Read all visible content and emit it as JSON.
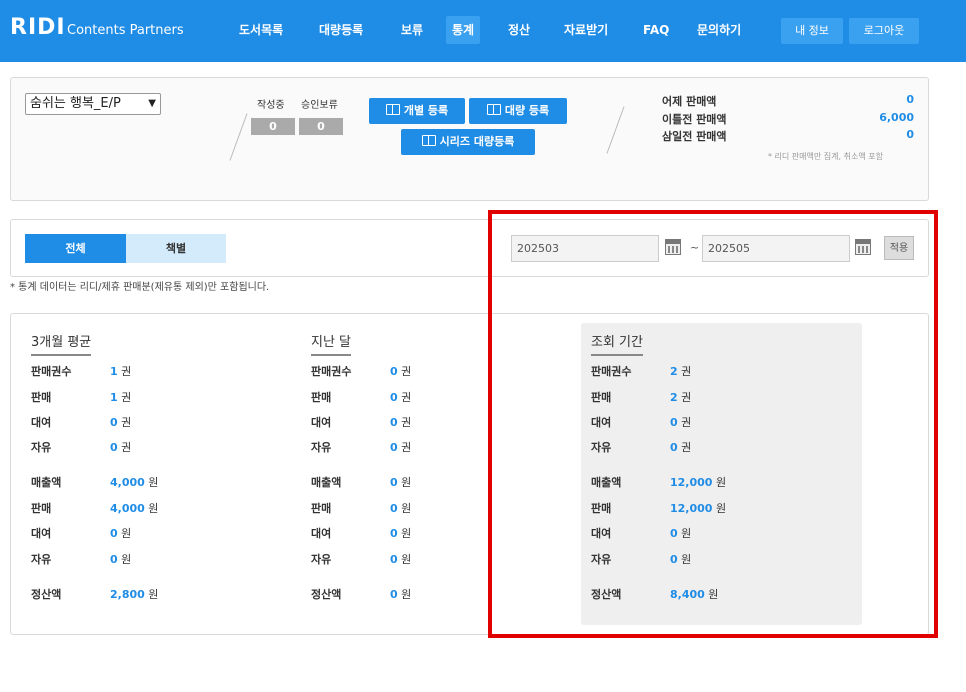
{
  "header": {
    "logo": "RIDI",
    "logo_sub": "Contents Partners",
    "nav": [
      "도서목록",
      "대량등록",
      "보류",
      "통계",
      "정산",
      "자료받기",
      "FAQ",
      "문의하기"
    ],
    "active_nav": "통계",
    "my_info": "내 정보",
    "logout": "로그아웃"
  },
  "summary": {
    "book_select": "숨쉬는 행복_E/P",
    "writing_label": "작성중",
    "writing_value": "0",
    "pending_label": "승인보류",
    "pending_value": "0",
    "btn_single": "개별 등록",
    "btn_bulk": "대량 등록",
    "btn_series": "시리즈 대량등록",
    "sales": [
      {
        "label": "어제 판매액",
        "value": "0"
      },
      {
        "label": "이틀전 판매액",
        "value": "6,000"
      },
      {
        "label": "삼일전 판매액",
        "value": "0"
      }
    ],
    "note": "* 리디 판매액만 집계, 취소액 포함"
  },
  "filter": {
    "tab_all": "전체",
    "tab_book": "책별",
    "date_from": "202503",
    "date_sep": "~",
    "date_to": "202505",
    "apply": "적용"
  },
  "notice": "* 통계 데이터는 리디/제휴 판매분(제유통 제외)만 포함됩니다.",
  "stats": {
    "unit_book": "권",
    "unit_won": "원",
    "columns": [
      {
        "title": "3개월 평균",
        "rows": {
          "sold_count": "1",
          "sale_count": "1",
          "rent_count": "0",
          "free_count": "0",
          "revenue": "4,000",
          "sale_amount": "4,000",
          "rent_amount": "0",
          "free_amount": "0",
          "settlement": "2,800"
        }
      },
      {
        "title": "지난 달",
        "rows": {
          "sold_count": "0",
          "sale_count": "0",
          "rent_count": "0",
          "free_count": "0",
          "revenue": "0",
          "sale_amount": "0",
          "rent_amount": "0",
          "free_amount": "0",
          "settlement": "0"
        }
      },
      {
        "title": "조회 기간",
        "rows": {
          "sold_count": "2",
          "sale_count": "2",
          "rent_count": "0",
          "free_count": "0",
          "revenue": "12,000",
          "sale_amount": "12,000",
          "rent_amount": "0",
          "free_amount": "0",
          "settlement": "8,400"
        }
      }
    ],
    "labels": {
      "sold_count": "판매권수",
      "sale_count": "판매",
      "rent_count": "대여",
      "free_count": "자유",
      "revenue": "매출액",
      "sale_amount": "판매",
      "rent_amount": "대여",
      "free_amount": "자유",
      "settlement": "정산액"
    }
  },
  "colors": {
    "brand": "#1f8ce6",
    "highlight": "#e00000"
  }
}
